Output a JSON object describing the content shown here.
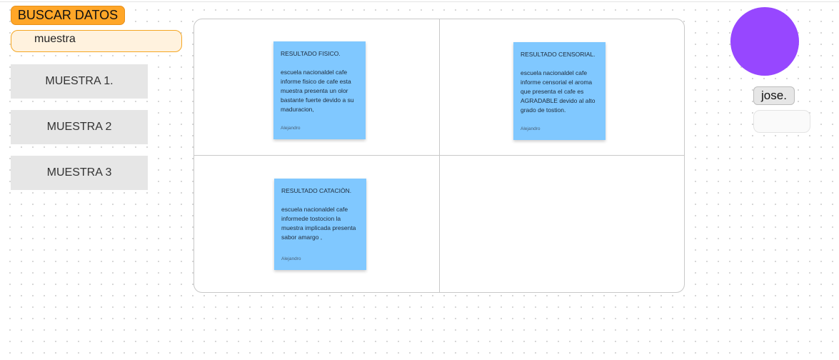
{
  "search_button": "BUSCAR DATOS",
  "search_value": "muestra",
  "samples": [
    "MUESTRA 1.",
    "MUESTRA 2",
    "MUESTRA 3"
  ],
  "notes": [
    {
      "title": "RESULTADO FISICO.",
      "body": "escuela nacionaldel cafe informe fisico de cafe esta muestra presenta un olor bastante fuerte devido a su maduracion,",
      "author": "Alejandro"
    },
    {
      "title": "RESULTADO CENSORIAL.",
      "body": "escuela nacionaldel cafe informe censorial el aroma que presenta el cafe es AGRADABLE  devido al alto grado de tostion.",
      "author": "Alejandro"
    },
    {
      "title": "RESULTADO CATACIÒN.",
      "body": "escuela nacionaldel cafe informede tostocion la muestra implicada presenta sabor amargo ,",
      "author": "Alejandro"
    }
  ],
  "user": {
    "name": "jose.",
    "avatar_color": "#9747ff"
  }
}
